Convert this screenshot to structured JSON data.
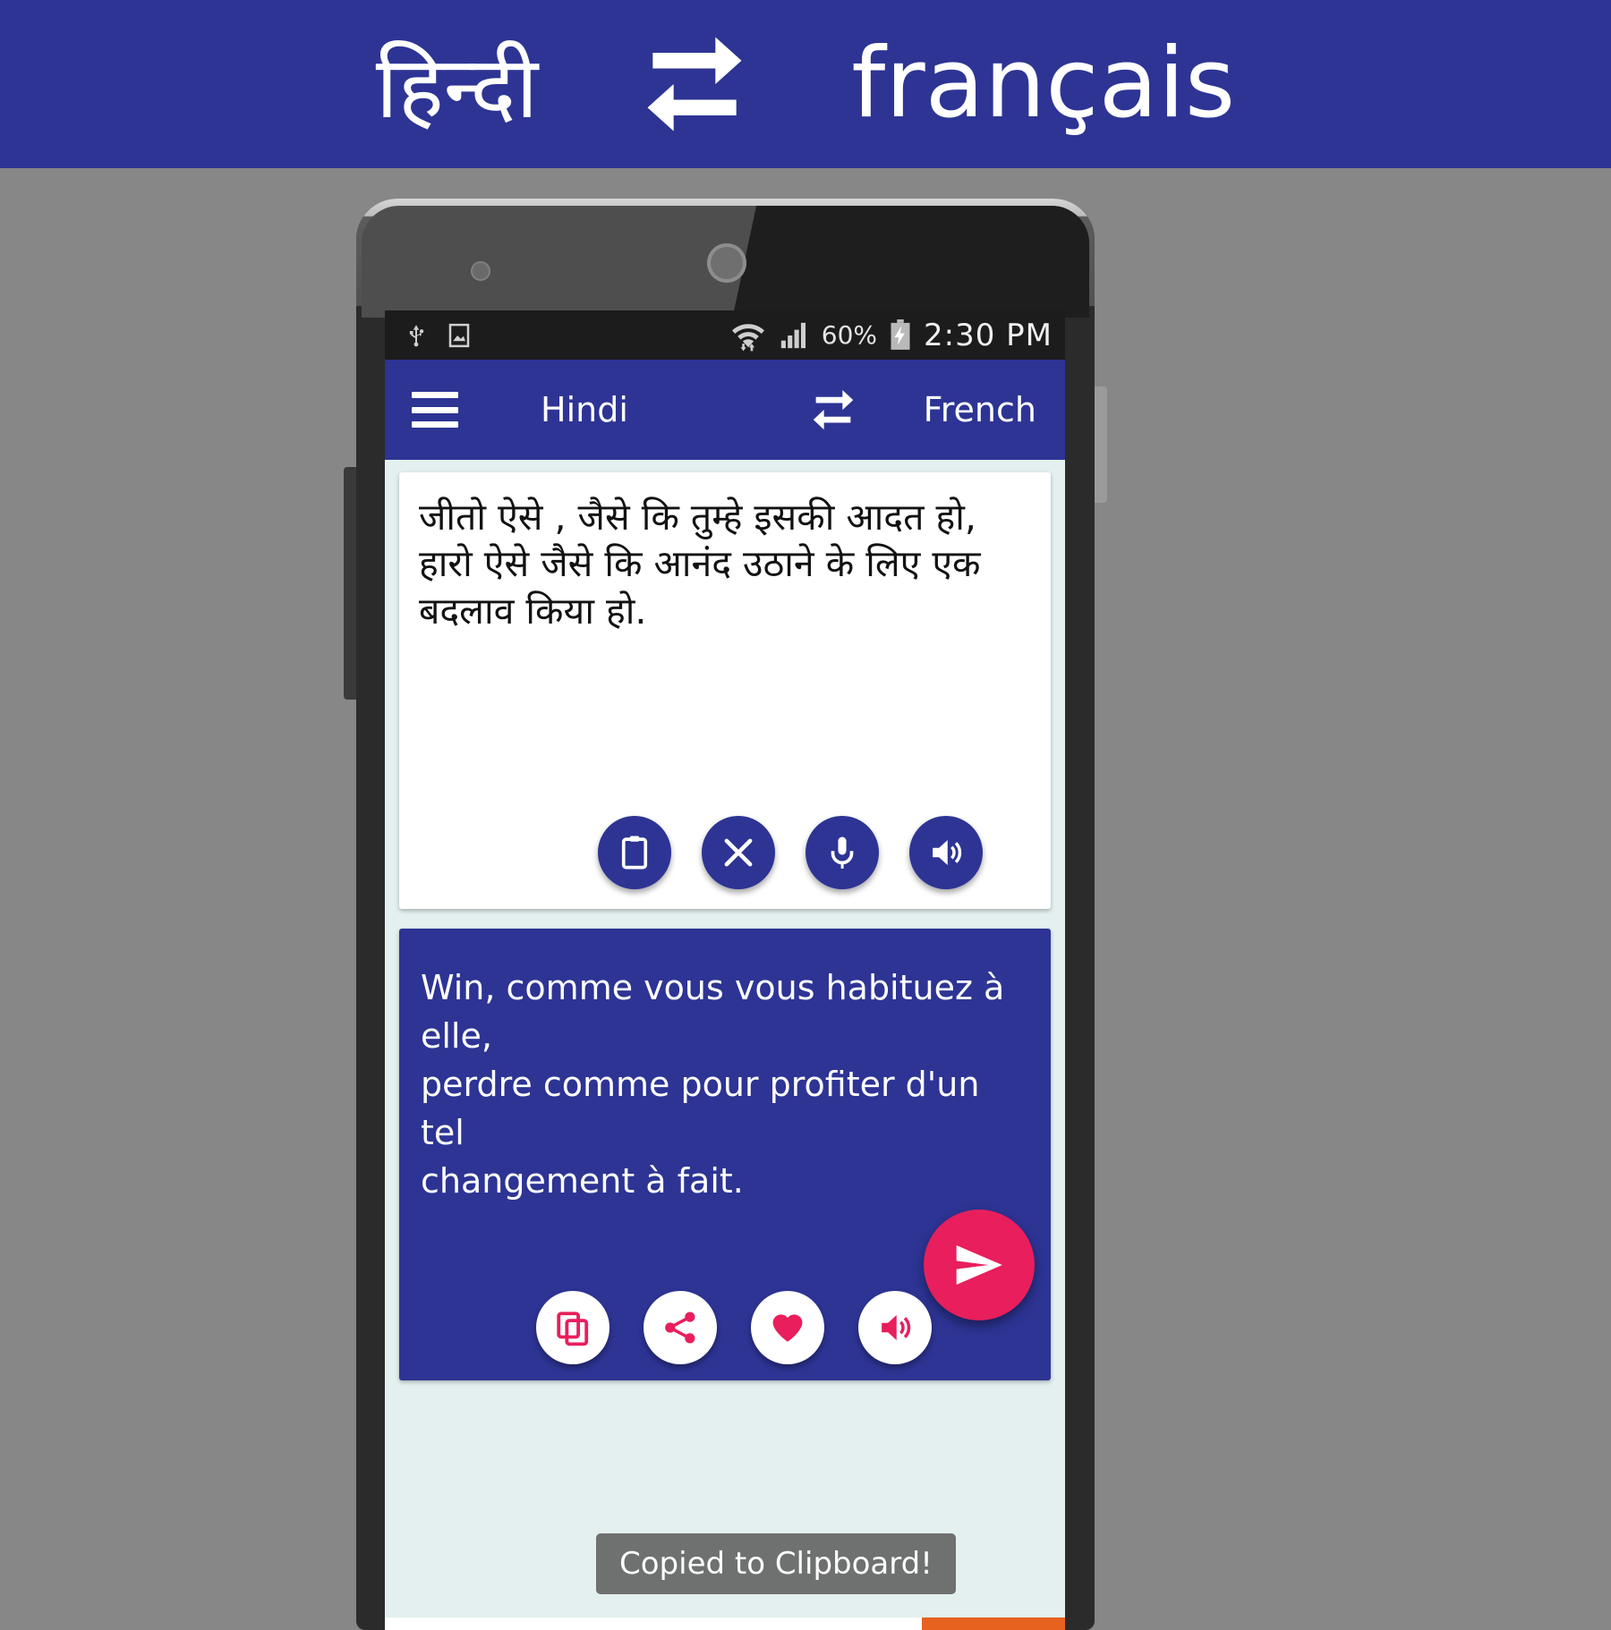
{
  "banner": {
    "source_language": "हिन्दी",
    "target_language": "français",
    "swap_icon": "swap-languages-icon",
    "background_color": "#2d3494"
  },
  "phone": {
    "statusbar": {
      "icons_left": [
        "usb-icon",
        "screenshot-image-icon"
      ],
      "icons_right": [
        "wifi-icon",
        "cellular-signal-icon"
      ],
      "battery_percent": "60%",
      "battery_icon": "battery-charging-icon",
      "clock": "2:30 PM",
      "background_color": "#1c1c1c"
    },
    "toolbar": {
      "menu_icon": "hamburger-menu-icon",
      "source_language": "Hindi",
      "swap_icon": "swap-languages-icon",
      "target_language": "French",
      "background_color": "#2d3494"
    },
    "source_panel": {
      "text": "जीतो ऐसे , जैसे कि तुम्हे इसकी आदत हो,\nहारो ऐसे जैसे कि आनंद उठाने के लिए एक\nबदलाव किया हो.",
      "actions": [
        {
          "name": "paste-button",
          "icon": "clipboard-icon",
          "label": "Paste"
        },
        {
          "name": "clear-button",
          "icon": "close-x-icon",
          "label": "Clear"
        },
        {
          "name": "voice-input-button",
          "icon": "microphone-icon",
          "label": "Speak"
        },
        {
          "name": "speak-source-button",
          "icon": "speaker-volume-icon",
          "label": "Listen"
        }
      ],
      "background_color": "#ffffff"
    },
    "target_panel": {
      "text": "Win, comme vous vous habituez à elle,\nperdre comme pour profiter d'un tel\nchangement à fait.",
      "actions": [
        {
          "name": "copy-button",
          "icon": "copy-icon",
          "label": "Copy"
        },
        {
          "name": "share-button",
          "icon": "share-icon",
          "label": "Share"
        },
        {
          "name": "favorite-button",
          "icon": "heart-icon",
          "label": "Favorite"
        },
        {
          "name": "speak-target-button",
          "icon": "speaker-volume-icon",
          "label": "Listen"
        }
      ],
      "background_color": "#2d3494"
    },
    "translate_button": {
      "icon": "send-paper-plane-icon",
      "label": "Translate",
      "color": "#e91e5c"
    },
    "toast": {
      "message": "Copied to Clipboard!"
    }
  }
}
